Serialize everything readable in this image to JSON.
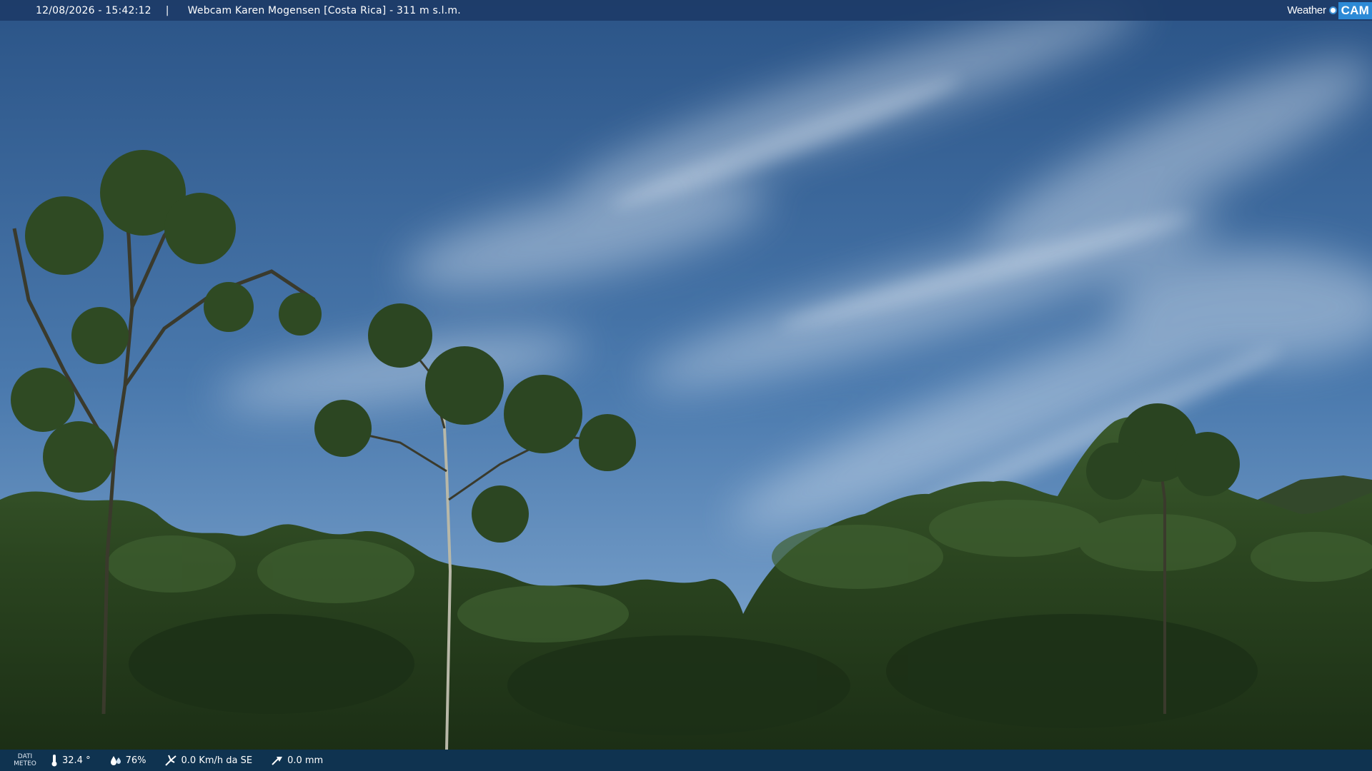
{
  "header": {
    "datetime": "12/08/2026 - 15:42:12",
    "separator": "|",
    "title": "Webcam Karen Mogensen [Costa Rica]  - 311 m s.l.m.",
    "brand_word": "Weather",
    "brand_cam": "CAM"
  },
  "footer": {
    "label_line1": "DATI",
    "label_line2": "METEO",
    "temperature": "32.4 °",
    "humidity": "76%",
    "wind": "0.0 Km/h da SE",
    "rain": "0.0 mm",
    "icons": [
      "thermometer-icon",
      "humidity-icon",
      "wind-icon",
      "rain-icon"
    ]
  },
  "colors": {
    "sky_top": "#2f5b8f",
    "sky_bottom": "#6d97c4",
    "forest": "#25391c",
    "bar": "#1c3a66",
    "brand_accent": "#2c8ad6"
  }
}
